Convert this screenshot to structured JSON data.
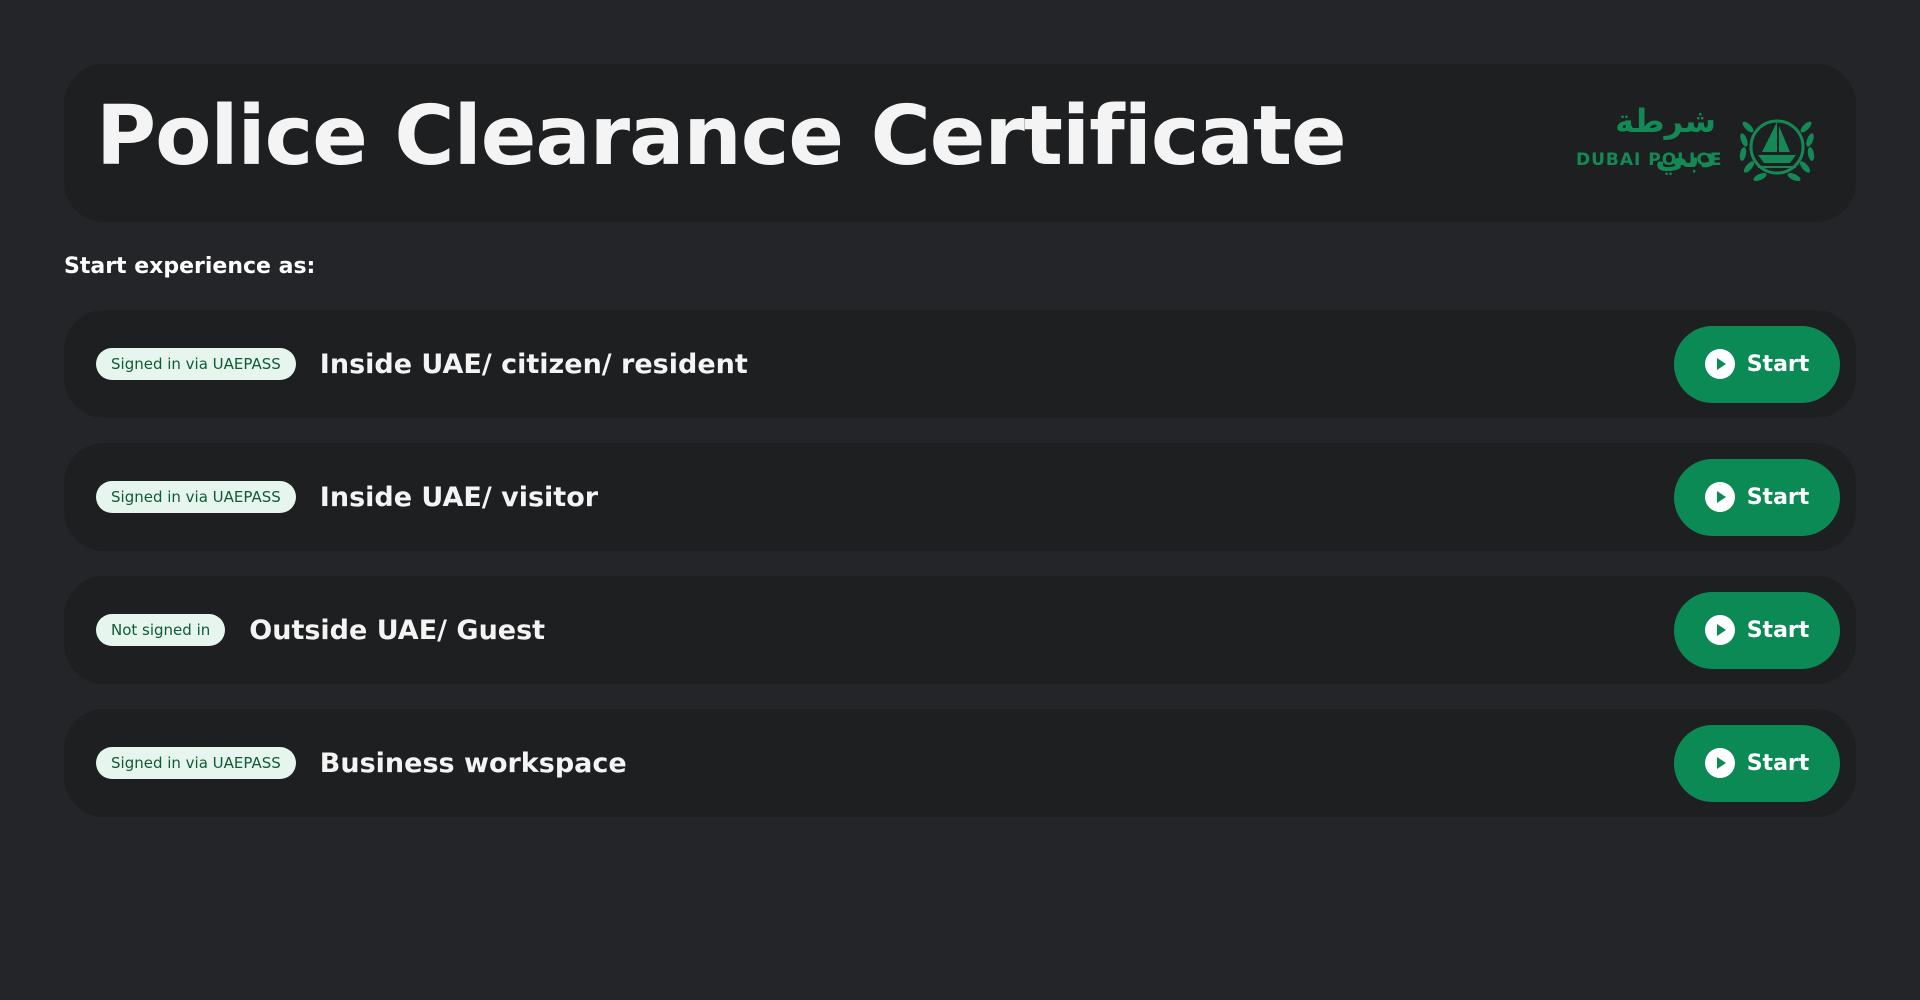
{
  "header": {
    "title": "Police Clearance Certificate",
    "logo": {
      "arabic_text": "شرطة دبي",
      "english_text": "DUBAI POLICE",
      "icon": "dubai-police-emblem-icon",
      "color": "#138a55"
    }
  },
  "section_label": "Start experience as:",
  "options": [
    {
      "badge": "Signed in via UAEPASS",
      "label": "Inside UAE/ citizen/ resident",
      "button_label": "Start"
    },
    {
      "badge": "Signed in via UAEPASS",
      "label": "Inside UAE/ visitor",
      "button_label": "Start"
    },
    {
      "badge": "Not signed in",
      "label": "Outside UAE/ Guest",
      "button_label": "Start"
    },
    {
      "badge": "Signed in via UAEPASS",
      "label": "Business workspace",
      "button_label": "Start"
    }
  ],
  "colors": {
    "background": "#242528",
    "card": "#1e1f21",
    "accent": "#0b8a56",
    "badge_background": "#e6f5ee",
    "badge_text": "#0f5a37"
  },
  "icons": {
    "button_icon": "play-circle-icon"
  }
}
